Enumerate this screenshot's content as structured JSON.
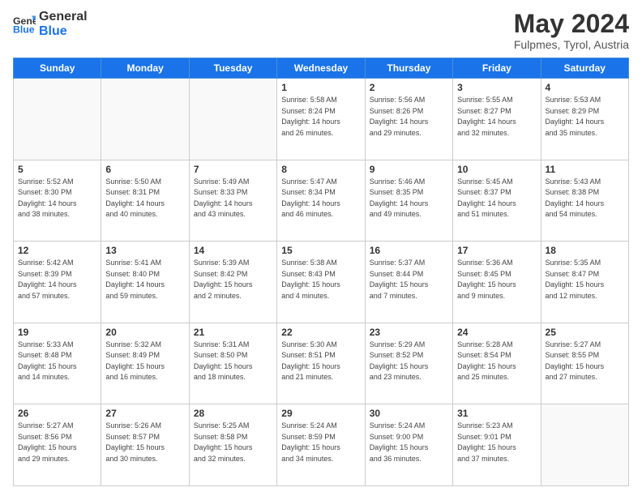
{
  "logo": {
    "line1": "General",
    "line2": "Blue"
  },
  "header": {
    "month": "May 2024",
    "location": "Fulpmes, Tyrol, Austria"
  },
  "weekdays": [
    "Sunday",
    "Monday",
    "Tuesday",
    "Wednesday",
    "Thursday",
    "Friday",
    "Saturday"
  ],
  "weeks": [
    [
      {
        "day": "",
        "info": ""
      },
      {
        "day": "",
        "info": ""
      },
      {
        "day": "",
        "info": ""
      },
      {
        "day": "1",
        "info": "Sunrise: 5:58 AM\nSunset: 8:24 PM\nDaylight: 14 hours\nand 26 minutes."
      },
      {
        "day": "2",
        "info": "Sunrise: 5:56 AM\nSunset: 8:26 PM\nDaylight: 14 hours\nand 29 minutes."
      },
      {
        "day": "3",
        "info": "Sunrise: 5:55 AM\nSunset: 8:27 PM\nDaylight: 14 hours\nand 32 minutes."
      },
      {
        "day": "4",
        "info": "Sunrise: 5:53 AM\nSunset: 8:29 PM\nDaylight: 14 hours\nand 35 minutes."
      }
    ],
    [
      {
        "day": "5",
        "info": "Sunrise: 5:52 AM\nSunset: 8:30 PM\nDaylight: 14 hours\nand 38 minutes."
      },
      {
        "day": "6",
        "info": "Sunrise: 5:50 AM\nSunset: 8:31 PM\nDaylight: 14 hours\nand 40 minutes."
      },
      {
        "day": "7",
        "info": "Sunrise: 5:49 AM\nSunset: 8:33 PM\nDaylight: 14 hours\nand 43 minutes."
      },
      {
        "day": "8",
        "info": "Sunrise: 5:47 AM\nSunset: 8:34 PM\nDaylight: 14 hours\nand 46 minutes."
      },
      {
        "day": "9",
        "info": "Sunrise: 5:46 AM\nSunset: 8:35 PM\nDaylight: 14 hours\nand 49 minutes."
      },
      {
        "day": "10",
        "info": "Sunrise: 5:45 AM\nSunset: 8:37 PM\nDaylight: 14 hours\nand 51 minutes."
      },
      {
        "day": "11",
        "info": "Sunrise: 5:43 AM\nSunset: 8:38 PM\nDaylight: 14 hours\nand 54 minutes."
      }
    ],
    [
      {
        "day": "12",
        "info": "Sunrise: 5:42 AM\nSunset: 8:39 PM\nDaylight: 14 hours\nand 57 minutes."
      },
      {
        "day": "13",
        "info": "Sunrise: 5:41 AM\nSunset: 8:40 PM\nDaylight: 14 hours\nand 59 minutes."
      },
      {
        "day": "14",
        "info": "Sunrise: 5:39 AM\nSunset: 8:42 PM\nDaylight: 15 hours\nand 2 minutes."
      },
      {
        "day": "15",
        "info": "Sunrise: 5:38 AM\nSunset: 8:43 PM\nDaylight: 15 hours\nand 4 minutes."
      },
      {
        "day": "16",
        "info": "Sunrise: 5:37 AM\nSunset: 8:44 PM\nDaylight: 15 hours\nand 7 minutes."
      },
      {
        "day": "17",
        "info": "Sunrise: 5:36 AM\nSunset: 8:45 PM\nDaylight: 15 hours\nand 9 minutes."
      },
      {
        "day": "18",
        "info": "Sunrise: 5:35 AM\nSunset: 8:47 PM\nDaylight: 15 hours\nand 12 minutes."
      }
    ],
    [
      {
        "day": "19",
        "info": "Sunrise: 5:33 AM\nSunset: 8:48 PM\nDaylight: 15 hours\nand 14 minutes."
      },
      {
        "day": "20",
        "info": "Sunrise: 5:32 AM\nSunset: 8:49 PM\nDaylight: 15 hours\nand 16 minutes."
      },
      {
        "day": "21",
        "info": "Sunrise: 5:31 AM\nSunset: 8:50 PM\nDaylight: 15 hours\nand 18 minutes."
      },
      {
        "day": "22",
        "info": "Sunrise: 5:30 AM\nSunset: 8:51 PM\nDaylight: 15 hours\nand 21 minutes."
      },
      {
        "day": "23",
        "info": "Sunrise: 5:29 AM\nSunset: 8:52 PM\nDaylight: 15 hours\nand 23 minutes."
      },
      {
        "day": "24",
        "info": "Sunrise: 5:28 AM\nSunset: 8:54 PM\nDaylight: 15 hours\nand 25 minutes."
      },
      {
        "day": "25",
        "info": "Sunrise: 5:27 AM\nSunset: 8:55 PM\nDaylight: 15 hours\nand 27 minutes."
      }
    ],
    [
      {
        "day": "26",
        "info": "Sunrise: 5:27 AM\nSunset: 8:56 PM\nDaylight: 15 hours\nand 29 minutes."
      },
      {
        "day": "27",
        "info": "Sunrise: 5:26 AM\nSunset: 8:57 PM\nDaylight: 15 hours\nand 30 minutes."
      },
      {
        "day": "28",
        "info": "Sunrise: 5:25 AM\nSunset: 8:58 PM\nDaylight: 15 hours\nand 32 minutes."
      },
      {
        "day": "29",
        "info": "Sunrise: 5:24 AM\nSunset: 8:59 PM\nDaylight: 15 hours\nand 34 minutes."
      },
      {
        "day": "30",
        "info": "Sunrise: 5:24 AM\nSunset: 9:00 PM\nDaylight: 15 hours\nand 36 minutes."
      },
      {
        "day": "31",
        "info": "Sunrise: 5:23 AM\nSunset: 9:01 PM\nDaylight: 15 hours\nand 37 minutes."
      },
      {
        "day": "",
        "info": ""
      }
    ]
  ]
}
